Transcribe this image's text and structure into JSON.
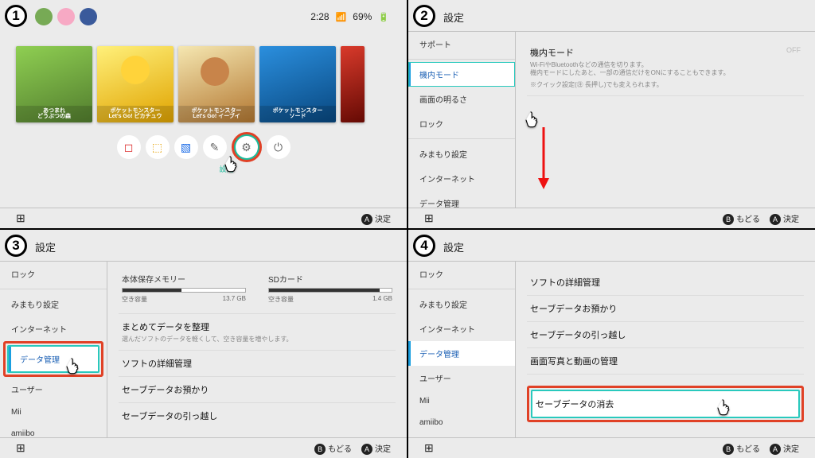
{
  "panel_numbers": [
    "1",
    "2",
    "3",
    "4"
  ],
  "home": {
    "time": "2:28",
    "battery": "69%",
    "tiles": [
      {
        "title": "あつまれ",
        "subtitle": "どうぶつの森"
      },
      {
        "title": "ポケットモンスター",
        "subtitle": "Let's Go! ピカチュウ"
      },
      {
        "title": "ポケットモンスター",
        "subtitle": "Let's Go! イーブイ"
      },
      {
        "title": "ポケットモンスター",
        "subtitle": "ソード"
      },
      {
        "title": "",
        "subtitle": ""
      }
    ],
    "dock": {
      "icons": [
        "news-icon",
        "eshop-icon",
        "album-icon",
        "controllers-icon",
        "settings-icon",
        "power-icon"
      ],
      "settings_label": "設定"
    },
    "footer_ok": "決定"
  },
  "settings_title": "設定",
  "panel2": {
    "sidebar": [
      "サポート",
      "機内モード",
      "画面の明るさ",
      "ロック",
      "みまもり設定",
      "インターネット",
      "データ管理"
    ],
    "selected_index": 1,
    "main": {
      "title": "機内モード",
      "off": "OFF",
      "desc1": "Wi-FiやBluetoothなどの通信を切ります。",
      "desc2": "機内モードにしたあと、一部の通信だけをONにすることもできます。",
      "desc3": "※クイック設定(㊟ 長押し)でも変えられます。"
    }
  },
  "panel3": {
    "sidebar": [
      "ロック",
      "みまもり設定",
      "インターネット",
      "データ管理",
      "ユーザー",
      "Mii",
      "amiibo"
    ],
    "selected_index": 3,
    "storage": {
      "internal_label": "本体保存メモリー",
      "internal_free_label": "空き容量",
      "internal_free": "13.7 GB",
      "internal_fill_pct": 48,
      "sd_label": "SDカード",
      "sd_free_label": "空き容量",
      "sd_free": "1.4 GB",
      "sd_fill_pct": 90
    },
    "rows": {
      "bulk_title": "まとめてデータを整理",
      "bulk_sub": "選んだソフトのデータを軽くして、空き容量を増やします。",
      "detail": "ソフトの詳細管理",
      "save_deposit": "セーブデータお預かり",
      "save_move": "セーブデータの引っ越し"
    }
  },
  "panel4": {
    "sidebar": [
      "ロック",
      "みまもり設定",
      "インターネット",
      "データ管理",
      "ユーザー",
      "Mii",
      "amiibo"
    ],
    "selected_index": 3,
    "rows": {
      "detail": "ソフトの詳細管理",
      "save_deposit": "セーブデータお預かり",
      "save_move": "セーブデータの引っ越し",
      "screenshots": "画面写真と動画の管理",
      "save_delete": "セーブデータの消去"
    }
  },
  "footer": {
    "back": "もどる",
    "ok": "決定"
  }
}
